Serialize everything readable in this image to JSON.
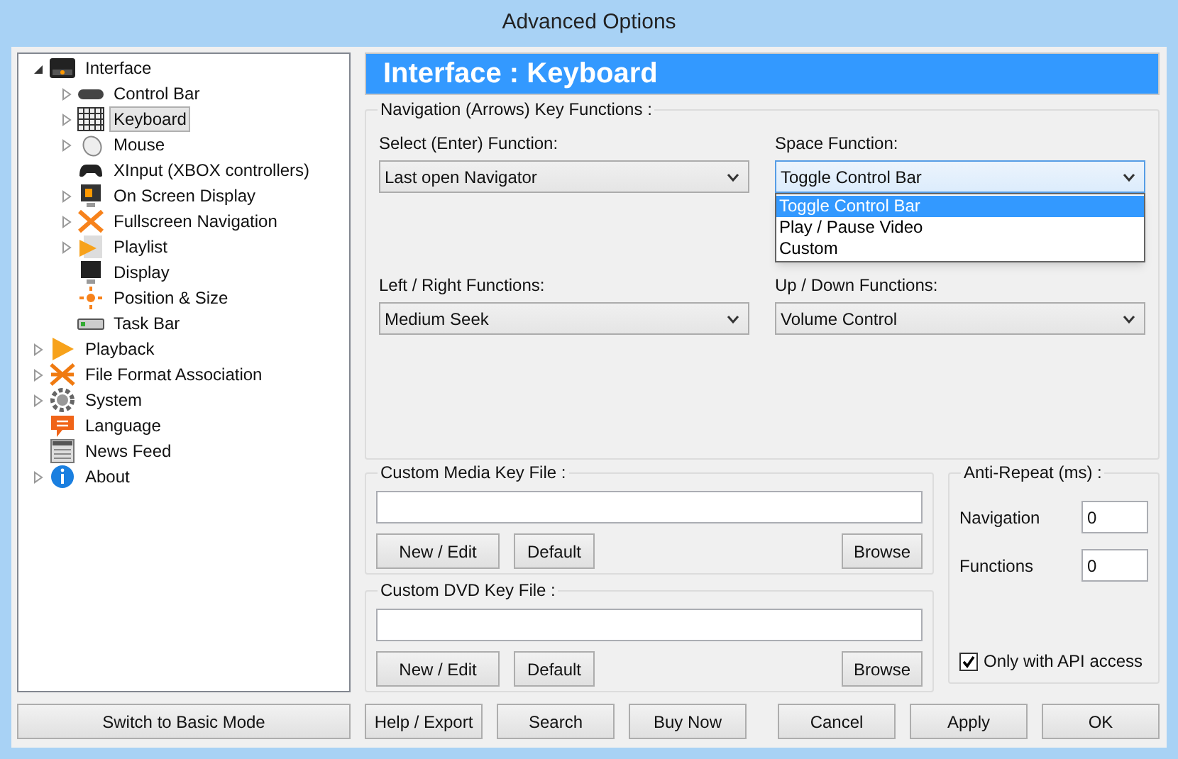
{
  "window": {
    "title": "Advanced Options"
  },
  "tree": [
    {
      "label": "Interface",
      "expandable": true,
      "expanded": true,
      "selected": false,
      "children": [
        {
          "label": "Control Bar",
          "expandable": true,
          "expanded": false,
          "selected": false
        },
        {
          "label": "Keyboard",
          "expandable": true,
          "expanded": false,
          "selected": true
        },
        {
          "label": "Mouse",
          "expandable": true,
          "expanded": false,
          "selected": false
        },
        {
          "label": "XInput (XBOX controllers)",
          "expandable": false,
          "selected": false
        },
        {
          "label": "On Screen Display",
          "expandable": true,
          "expanded": false,
          "selected": false
        },
        {
          "label": "Fullscreen Navigation",
          "expandable": true,
          "expanded": false,
          "selected": false
        },
        {
          "label": "Playlist",
          "expandable": true,
          "expanded": false,
          "selected": false
        },
        {
          "label": "Display",
          "expandable": false,
          "selected": false
        },
        {
          "label": "Position & Size",
          "expandable": false,
          "selected": false
        },
        {
          "label": "Task Bar",
          "expandable": false,
          "selected": false
        }
      ]
    },
    {
      "label": "Playback",
      "expandable": true,
      "expanded": false,
      "selected": false
    },
    {
      "label": "File Format Association",
      "expandable": true,
      "expanded": false,
      "selected": false
    },
    {
      "label": "System",
      "expandable": true,
      "expanded": false,
      "selected": false
    },
    {
      "label": "Language",
      "expandable": false,
      "selected": false
    },
    {
      "label": "News Feed",
      "expandable": false,
      "selected": false
    },
    {
      "label": "About",
      "expandable": true,
      "expanded": false,
      "selected": false
    }
  ],
  "header": "Interface : Keyboard",
  "navigation_group": {
    "title": "Navigation (Arrows) Key Functions :",
    "selects": [
      {
        "label": "Select (Enter) Function:",
        "value": "Last open Navigator",
        "open": false
      },
      {
        "label": "Space Function:",
        "value": "Toggle Control Bar",
        "open": true,
        "options": [
          {
            "label": "Toggle Control Bar",
            "selected": true
          },
          {
            "label": "Play / Pause Video",
            "selected": false
          },
          {
            "label": "Custom",
            "selected": false
          }
        ]
      },
      {
        "label": "Left / Right Functions:",
        "value": "Medium Seek",
        "open": false
      },
      {
        "label": "Up / Down Functions:",
        "value": "Volume Control",
        "open": false
      }
    ]
  },
  "file_groups": [
    {
      "title": "Custom Media Key File :",
      "buttons": [
        "New / Edit",
        "Default",
        "Browse"
      ]
    },
    {
      "title": "Custom DVD Key File :",
      "buttons": [
        "New / Edit",
        "Default",
        "Browse"
      ]
    }
  ],
  "anti_repeat": {
    "title": "Anti-Repeat (ms) :",
    "fields": [
      {
        "label": "Navigation",
        "value": "0"
      },
      {
        "label": "Functions",
        "value": "0"
      }
    ],
    "api_only": {
      "label": "Only with API access",
      "checked": true
    }
  },
  "switch_button": "Switch to Basic Mode",
  "buttons": [
    "Help / Export",
    "Search",
    "Buy Now",
    "Cancel",
    "Apply",
    "OK"
  ]
}
